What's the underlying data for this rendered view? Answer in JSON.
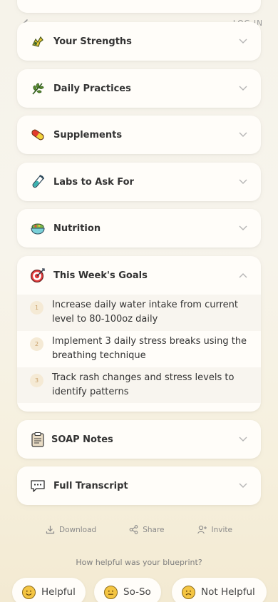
{
  "header": {
    "login_label": "LOG IN"
  },
  "sections": [
    {
      "id": "strengths",
      "title": "Your Strengths",
      "icon": "flexed-arm-icon"
    },
    {
      "id": "practices",
      "title": "Daily Practices",
      "icon": "herb-icon"
    },
    {
      "id": "supplements",
      "title": "Supplements",
      "icon": "pill-icon"
    },
    {
      "id": "labs",
      "title": "Labs to Ask For",
      "icon": "test-tube-icon"
    },
    {
      "id": "nutrition",
      "title": "Nutrition",
      "icon": "salad-bowl-icon"
    },
    {
      "id": "goals",
      "title": "This Week's Goals",
      "icon": "target-icon",
      "expanded": true
    },
    {
      "id": "soap",
      "title": "SOAP Notes",
      "icon": "clipboard-icon"
    },
    {
      "id": "transcript",
      "title": "Full Transcript",
      "icon": "chat-icon"
    }
  ],
  "goals": [
    {
      "num": "1",
      "text": "Increase daily water intake from current level to 80-100oz daily"
    },
    {
      "num": "2",
      "text": "Implement 3 daily stress breaks using the breathing technique"
    },
    {
      "num": "3",
      "text": "Track rash changes and stress levels to identify patterns"
    }
  ],
  "actions": {
    "download": "Download",
    "share": "Share",
    "invite": "Invite"
  },
  "feedback": {
    "question": "How helpful was your blueprint?",
    "helpful": "Helpful",
    "soso": "So-So",
    "not_helpful": "Not Helpful"
  }
}
